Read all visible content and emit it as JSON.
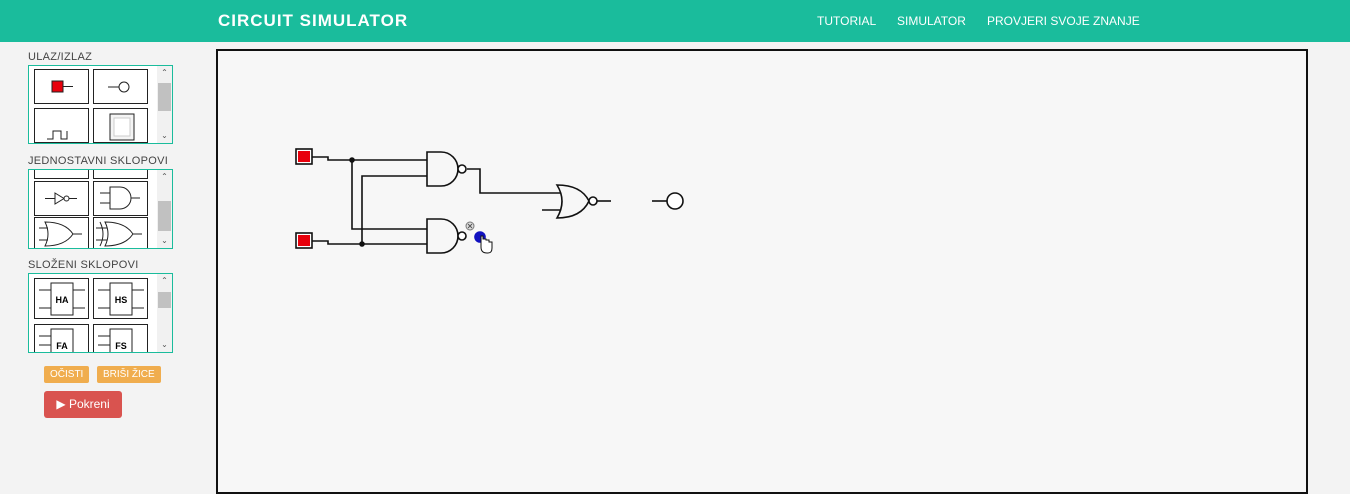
{
  "navbar": {
    "brand": "CIRCUIT SIMULATOR",
    "links": [
      "TUTORIAL",
      "SIMULATOR",
      "PROVJERI SVOJE ZNANJE"
    ]
  },
  "sidebar": {
    "sections": [
      {
        "label": "ULAZ/IZLAZ",
        "items": [
          "input-switch",
          "output-lamp",
          "clock",
          "display"
        ]
      },
      {
        "label": "JEDNOSTAVNI SKLOPOVI",
        "items": [
          "buffer",
          "and-gate",
          "not-gate",
          "nand-gate",
          "or-gate",
          "xor-gate"
        ]
      },
      {
        "label": "SLOŽENI SKLOPOVI",
        "items": [
          "HA",
          "HS",
          "FA",
          "FS"
        ]
      }
    ],
    "buttons": {
      "clear": "OČISTI",
      "delete_wires": "BRIŠI ŽICE",
      "run": "▶ Pokreni"
    }
  },
  "colors": {
    "accent": "#1abc9c",
    "warning": "#f0ad4e",
    "danger": "#d9534f",
    "input_on": "#e8000c",
    "pin_selected": "#1010c0"
  },
  "circuit": {
    "components": [
      "input-switch-1",
      "input-switch-2",
      "nand-gate-1",
      "nand-gate-2",
      "nor-gate",
      "output-lamp"
    ]
  }
}
